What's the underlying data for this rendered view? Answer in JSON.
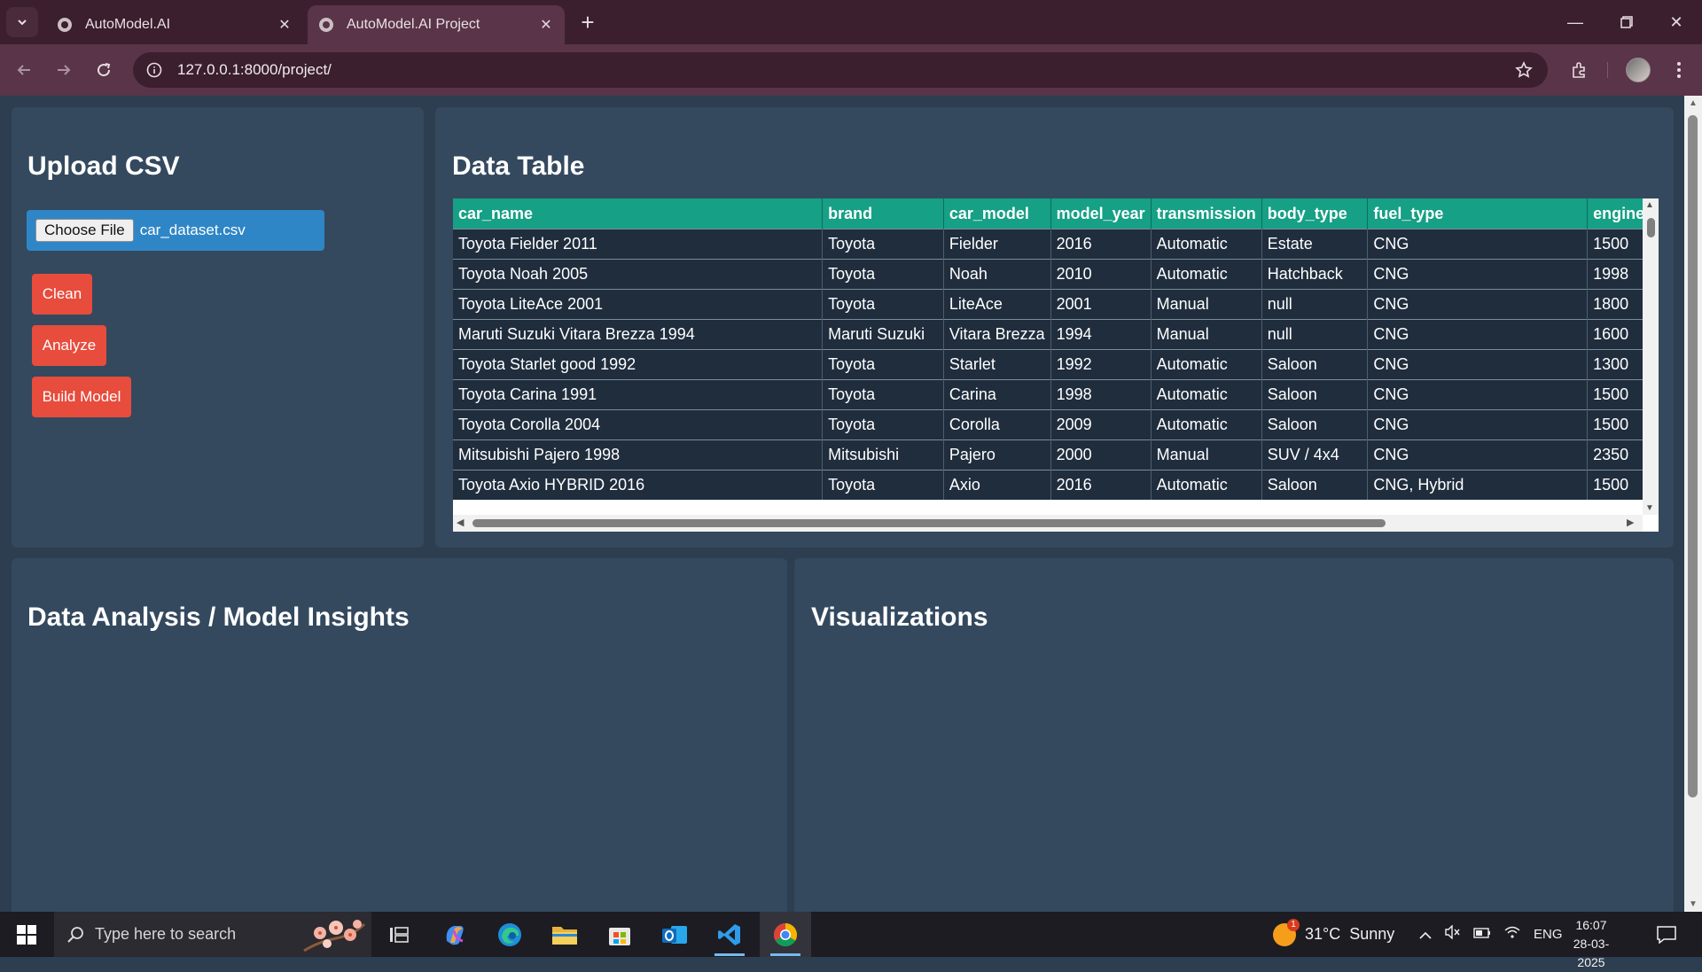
{
  "browser": {
    "tabs": [
      {
        "title": "AutoModel.AI",
        "active": false
      },
      {
        "title": "AutoModel.AI Project",
        "active": true
      }
    ],
    "url": "127.0.0.1:8000/project/"
  },
  "upload_panel": {
    "heading": "Upload CSV",
    "choose_file_label": "Choose File",
    "file_name": "car_dataset.csv",
    "buttons": [
      "Clean",
      "Analyze",
      "Build Model"
    ]
  },
  "data_table": {
    "heading": "Data Table",
    "columns": [
      "car_name",
      "brand",
      "car_model",
      "model_year",
      "transmission",
      "body_type",
      "fuel_type",
      "engine"
    ],
    "rows": [
      [
        "Toyota Fielder 2011",
        "Toyota",
        "Fielder",
        "2016",
        "Automatic",
        "Estate",
        "CNG",
        "1500"
      ],
      [
        "Toyota Noah 2005",
        "Toyota",
        "Noah",
        "2010",
        "Automatic",
        "Hatchback",
        "CNG",
        "1998"
      ],
      [
        "Toyota LiteAce 2001",
        "Toyota",
        "LiteAce",
        "2001",
        "Manual",
        "null",
        "CNG",
        "1800"
      ],
      [
        "Maruti Suzuki Vitara Brezza 1994",
        "Maruti Suzuki",
        "Vitara Brezza",
        "1994",
        "Manual",
        "null",
        "CNG",
        "1600"
      ],
      [
        "Toyota Starlet good 1992",
        "Toyota",
        "Starlet",
        "1992",
        "Automatic",
        "Saloon",
        "CNG",
        "1300"
      ],
      [
        "Toyota Carina 1991",
        "Toyota",
        "Carina",
        "1998",
        "Automatic",
        "Saloon",
        "CNG",
        "1500"
      ],
      [
        "Toyota Corolla 2004",
        "Toyota",
        "Corolla",
        "2009",
        "Automatic",
        "Saloon",
        "CNG",
        "1500"
      ],
      [
        "Mitsubishi Pajero 1998",
        "Mitsubishi",
        "Pajero",
        "2000",
        "Manual",
        "SUV / 4x4",
        "CNG",
        "2350"
      ],
      [
        "Toyota Axio HYBRID 2016",
        "Toyota",
        "Axio",
        "2016",
        "Automatic",
        "Saloon",
        "CNG, Hybrid",
        "1500"
      ]
    ]
  },
  "analysis_panel": {
    "heading": "Data Analysis / Model Insights"
  },
  "visualizations_panel": {
    "heading": "Visualizations"
  },
  "taskbar": {
    "search_placeholder": "Type here to search",
    "weather": "31°C  Sunny",
    "weather_badge": "1",
    "language": "ENG",
    "time": "16:07",
    "date": "28-03-2025"
  }
}
